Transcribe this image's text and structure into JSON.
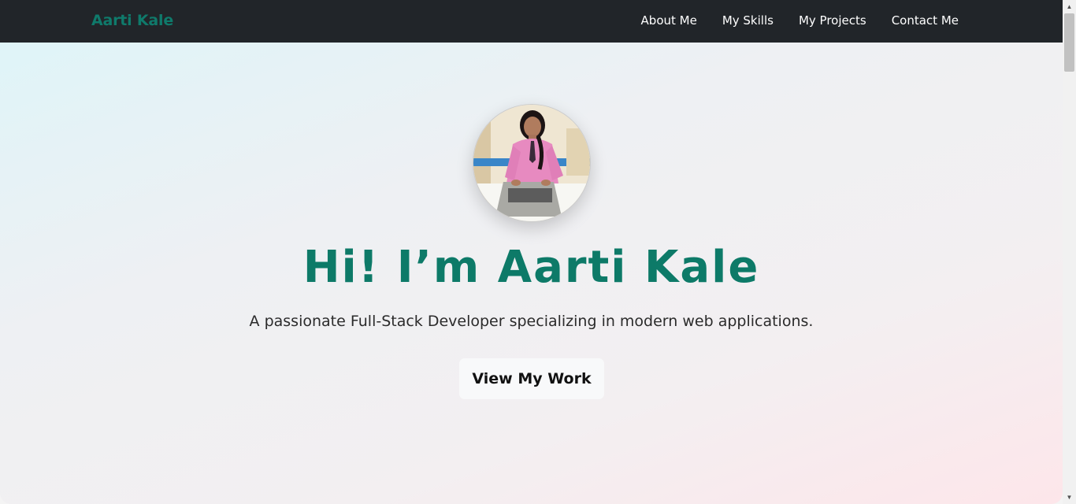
{
  "nav": {
    "brand": "Aarti Kale",
    "links": [
      {
        "label": "About Me"
      },
      {
        "label": "My Skills"
      },
      {
        "label": "My Projects"
      },
      {
        "label": "Contact Me"
      }
    ]
  },
  "hero": {
    "title": "Hi! I’m Aarti Kale",
    "subtitle": "A passionate Full-Stack Developer specializing in modern web applications.",
    "cta_label": "View My Work"
  },
  "colors": {
    "navbar_bg": "#212529",
    "brand": "#0f7a6b",
    "title": "#0d7a68",
    "button_bg": "#f8f9fa"
  },
  "icons": {
    "scroll_up": "scroll-up-arrow-icon",
    "scroll_down": "scroll-down-arrow-icon"
  }
}
